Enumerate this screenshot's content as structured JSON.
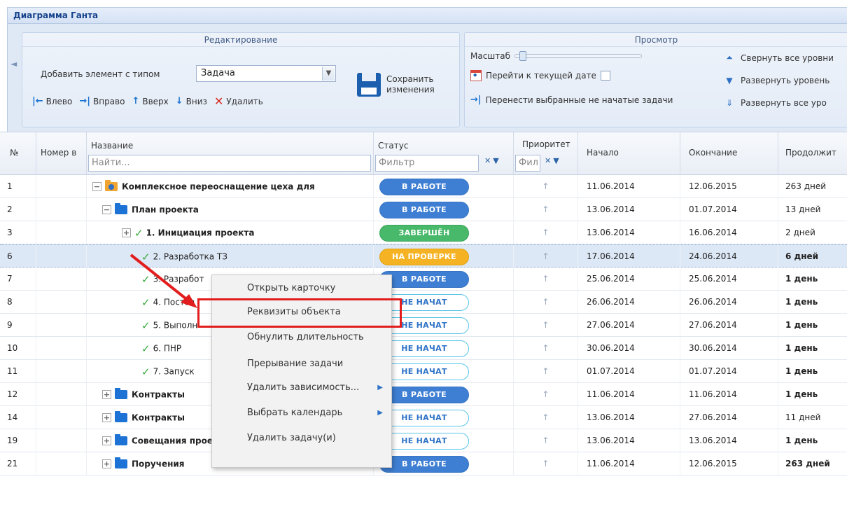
{
  "window": {
    "title": "Диаграмма Ганта"
  },
  "ribbon": {
    "edit_group": {
      "header": "Редактирование",
      "add_label": "Добавить элемент с типом",
      "type_value": "Задача",
      "save_label_1": "Сохранить",
      "save_label_2": "изменения",
      "move_left": "Влево",
      "move_right": "Вправо",
      "move_up": "Вверх",
      "move_down": "Вниз",
      "delete": "Удалить"
    },
    "view_group": {
      "header": "Просмотр",
      "zoom_label": "Масштаб",
      "goto_today": "Перейти к текущей дате",
      "shift_tasks": "Перенести выбранные не начатые задачи",
      "collapse_all": "Свернуть все уровни",
      "expand_levels": "Развернуть уровень",
      "expand_all": "Развернуть все уро"
    }
  },
  "grid": {
    "headers": {
      "num": "№",
      "nomer": "Номер в",
      "name": "Название",
      "name_placeholder": "Найти...",
      "status": "Статус",
      "status_placeholder": "Фильтр",
      "priority": "Приоритет",
      "priority_placeholder": "Фил",
      "start": "Начало",
      "end": "Окончание",
      "duration": "Продолжит"
    },
    "rows": [
      {
        "num": "1",
        "name": "Комплексное переоснащение цеха для",
        "status": "В РАБОТЕ",
        "priority": "↑",
        "start": "11.06.2014",
        "end": "12.06.2015",
        "duration": "263 дней"
      },
      {
        "num": "2",
        "name": "План проекта",
        "status": "В РАБОТЕ",
        "priority": "↑",
        "start": "13.06.2014",
        "end": "01.07.2014",
        "duration": "13 дней"
      },
      {
        "num": "3",
        "name": "1. Инициация проекта",
        "status": "ЗАВЕРШЁН",
        "priority": "↑",
        "start": "13.06.2014",
        "end": "16.06.2014",
        "duration": "2 дней"
      },
      {
        "num": "6",
        "name": "2. Разработка ТЗ",
        "status": "НА ПРОВЕРКЕ",
        "priority": "↑",
        "start": "17.06.2014",
        "end": "24.06.2014",
        "duration": "6 дней"
      },
      {
        "num": "7",
        "name": "3. Разработ",
        "status": "В РАБОТЕ",
        "priority": "↑",
        "start": "25.06.2014",
        "end": "25.06.2014",
        "duration": "1 день"
      },
      {
        "num": "8",
        "name": "4. Постав",
        "status": "НЕ НАЧАТ",
        "priority": "↑",
        "start": "26.06.2014",
        "end": "26.06.2014",
        "duration": "1 день"
      },
      {
        "num": "9",
        "name": "5. Выполн",
        "status": "НЕ НАЧАТ",
        "priority": "↑",
        "start": "27.06.2014",
        "end": "27.06.2014",
        "duration": "1 день"
      },
      {
        "num": "10",
        "name": "6. ПНР",
        "status": "НЕ НАЧАТ",
        "priority": "↑",
        "start": "30.06.2014",
        "end": "30.06.2014",
        "duration": "1 день"
      },
      {
        "num": "11",
        "name": "7. Запуск",
        "status": "НЕ НАЧАТ",
        "priority": "↑",
        "start": "01.07.2014",
        "end": "01.07.2014",
        "duration": "1 день"
      },
      {
        "num": "12",
        "name": "Контракты",
        "status": "В РАБОТЕ",
        "priority": "↑",
        "start": "11.06.2014",
        "end": "11.06.2014",
        "duration": "1 день"
      },
      {
        "num": "14",
        "name": "Контракты",
        "status": "НЕ НАЧАТ",
        "priority": "↑",
        "start": "13.06.2014",
        "end": "27.06.2014",
        "duration": "11 дней"
      },
      {
        "num": "19",
        "name": "Совещания проекта",
        "status": "НЕ НАЧАТ",
        "priority": "↑",
        "start": "13.06.2014",
        "end": "13.06.2014",
        "duration": "1 день"
      },
      {
        "num": "21",
        "name": "Поручения",
        "status": "В РАБОТЕ",
        "priority": "↑",
        "start": "11.06.2014",
        "end": "12.06.2015",
        "duration": "263 дней"
      }
    ]
  },
  "context_menu": {
    "items": [
      "Открыть карточку",
      "Реквизиты объекта",
      "Обнулить длительность",
      "Прерывание задачи",
      "Удалить зависимость...",
      "Выбрать календарь",
      "Удалить задачу(и)"
    ],
    "highlighted_index": 1
  },
  "colors": {
    "status_work": "#3f7fd3",
    "status_done": "#48b86a",
    "status_review": "#f5b323",
    "status_notstarted_border": "#58c4e8",
    "highlight": "#e21d1d"
  }
}
